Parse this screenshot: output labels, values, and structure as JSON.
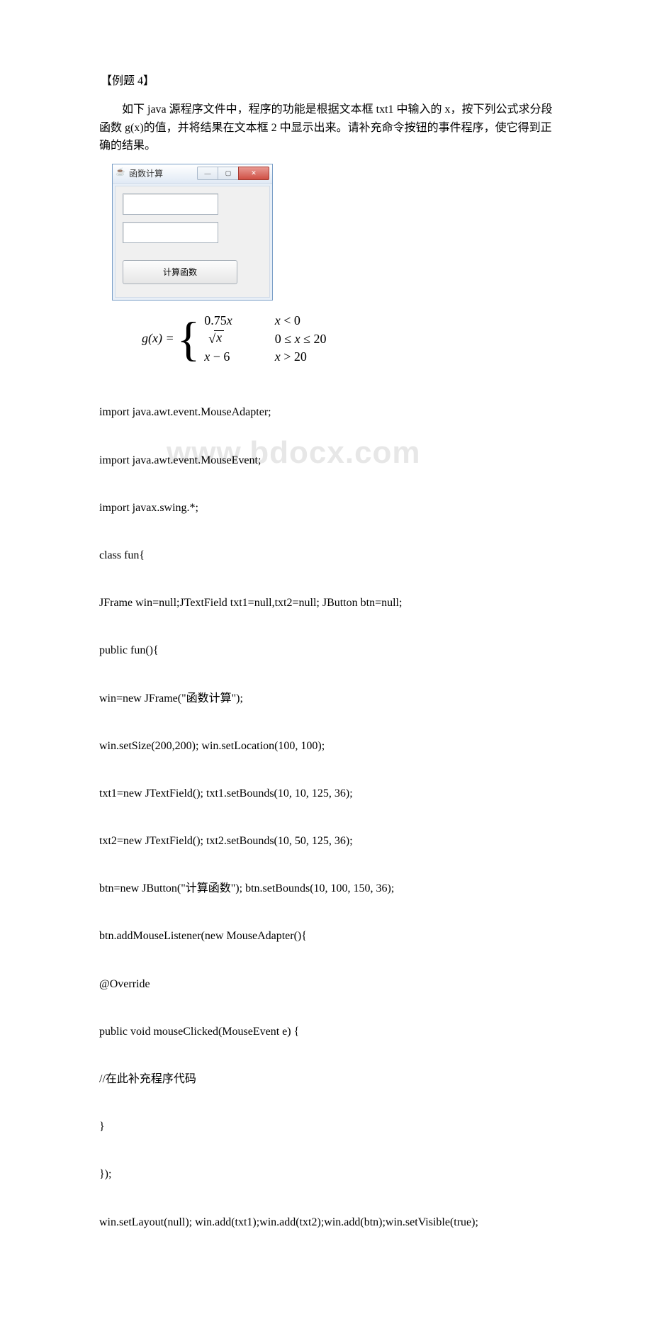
{
  "title": "【例题 4】",
  "paragraph": "如下 java 源程序文件中，程序的功能是根据文本框 txt1 中输入的 x，按下列公式求分段函数 g(x)的值，并将结果在文本框 2 中显示出来。请补充命令按钮的事件程序，使它得到正确的结果。",
  "watermark": "www.bdocx.com",
  "ui": {
    "window_title": "函数计算",
    "button_label": "计算函数",
    "min_symbol": "—",
    "max_symbol": "▢",
    "close_symbol": "✕"
  },
  "formula": {
    "left": "g(x) =",
    "cases": [
      {
        "expr_a": "0.75",
        "expr_b": "x",
        "cond": "x < 0"
      },
      {
        "expr_sqrt_arg": "x",
        "cond": "0 ≤ x ≤ 20"
      },
      {
        "expr_a": "x",
        "expr_b": " − 6",
        "cond": "x > 20"
      }
    ]
  },
  "code": {
    "l1": "import java.awt.event.MouseAdapter;",
    "l2": "import java.awt.event.MouseEvent;",
    "l3": "import javax.swing.*;",
    "l4": "class fun{",
    "l5": " JFrame win=null;JTextField txt1=null,txt2=null; JButton btn=null;",
    "l6": " public fun(){",
    "l7": "  win=new JFrame(\"函数计算\");",
    "l8": "win.setSize(200,200); win.setLocation(100, 100);",
    "l9": "  txt1=new JTextField(); txt1.setBounds(10, 10, 125, 36);",
    "l10": "  txt2=new JTextField(); txt2.setBounds(10, 50, 125, 36);",
    "l11": "  btn=new JButton(\"计算函数\");  btn.setBounds(10, 100, 150, 36);",
    "l12": "  btn.addMouseListener(new MouseAdapter(){",
    "l13": "   @Override",
    "l14": "   public void mouseClicked(MouseEvent e) {",
    "l15": "   //在此补充程序代码",
    "l16": "   }",
    "l17": "  });",
    "l18": "  win.setLayout(null); win.add(txt1);win.add(txt2);win.add(btn);win.setVisible(true);"
  }
}
